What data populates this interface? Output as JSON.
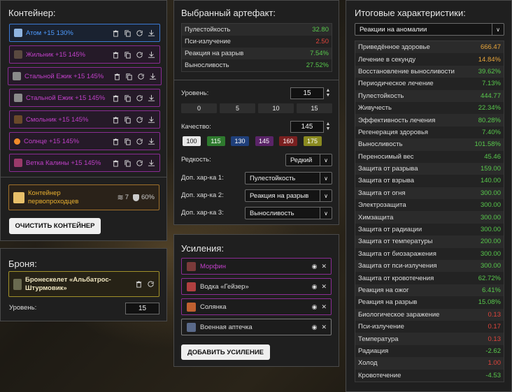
{
  "container": {
    "title": "Контейнер:",
    "items": [
      {
        "name": "Атом +15 130%",
        "color": "#4e9bff",
        "border": "#3b7ad4",
        "icon_color": "#8fb4e0",
        "icon": "atom-artifact-icon"
      },
      {
        "name": "Жильник +15 145%",
        "color": "#c040c8",
        "border": "#8a2c93",
        "icon_color": "#5a4a40",
        "icon": "zhilnik-artifact-icon"
      },
      {
        "name": "Стальной Ежик +15 145%",
        "color": "#c040c8",
        "border": "#8a2c93",
        "icon_color": "#8a8a8a",
        "icon": "steel-hedgehog-artifact-icon"
      },
      {
        "name": "Стальной Ежик +15 145%",
        "color": "#c040c8",
        "border": "#8a2c93",
        "icon_color": "#8a8a8a",
        "icon": "steel-hedgehog-artifact-icon"
      },
      {
        "name": "Смольник +15 145%",
        "color": "#c040c8",
        "border": "#8a2c93",
        "icon_color": "#6a4a2a",
        "icon": "smolnik-artifact-icon"
      },
      {
        "name": "Солнце +15 145%",
        "color": "#c040c8",
        "border": "#8a2c93",
        "icon_color": "#f08a2a",
        "icon": "sun-artifact-icon"
      },
      {
        "name": "Ветка Калины +15 145%",
        "color": "#c040c8",
        "border": "#8a2c93",
        "icon_color": "#9a3a6a",
        "icon": "viburnum-branch-artifact-icon"
      }
    ],
    "container_item": {
      "name": "Контейнер первопроходцев",
      "slots": "7",
      "protection": "60%"
    },
    "clear_button": "ОЧИСТИТЬ КОНТЕЙНЕР"
  },
  "armor": {
    "title": "Броня:",
    "name": "Бронескелет «Альбатрос-Штурмовик»",
    "level_label": "Уровень:",
    "level_value": "15"
  },
  "artifact": {
    "title": "Выбранный артефакт:",
    "stats": [
      {
        "label": "Пулестойкость",
        "value": "32.80",
        "color": "#58c94c"
      },
      {
        "label": "Пси-излучение",
        "value": "2.50",
        "color": "#e0453c"
      },
      {
        "label": "Реакция на разрыв",
        "value": "7.54%",
        "color": "#58c94c"
      },
      {
        "label": "Выносливость",
        "value": "27.52%",
        "color": "#58c94c"
      }
    ],
    "level_label": "Уровень:",
    "level_value": "15",
    "level_presets": [
      "0",
      "5",
      "10",
      "15"
    ],
    "quality_label": "Качество:",
    "quality_value": "145",
    "quality_presets": [
      {
        "label": "100",
        "bg": "#e8e8e8",
        "fg": "#111"
      },
      {
        "label": "115",
        "bg": "#2e7a2e",
        "fg": "#fff"
      },
      {
        "label": "130",
        "bg": "#1f3f7a",
        "fg": "#fff"
      },
      {
        "label": "145",
        "bg": "#5a2468",
        "fg": "#fff"
      },
      {
        "label": "160",
        "bg": "#7a2020",
        "fg": "#fff"
      },
      {
        "label": "175",
        "bg": "#8a8a20",
        "fg": "#fff"
      }
    ],
    "rarity_label": "Редкость:",
    "rarity_value": "Редкий",
    "extra_labels": [
      "Доп. хар-ка 1:",
      "Доп. хар-ка 2:",
      "Доп. хар-ка 3:"
    ],
    "extra_values": [
      "Пулестойкость",
      "Реакция на разрыв",
      "Выносливость"
    ]
  },
  "boosts": {
    "title": "Усиления:",
    "items": [
      {
        "name": "Морфин",
        "color": "#c040c8",
        "border": "#8a2c93",
        "icon_color": "#7a3a3a",
        "icon": "morphine-icon"
      },
      {
        "name": "Водка «Гейзер»",
        "color": "#ddd",
        "border": "#8a2c93",
        "icon_color": "#b04040",
        "icon": "vodka-icon"
      },
      {
        "name": "Солянка",
        "color": "#ddd",
        "border": "#8a2c93",
        "icon_color": "#c06030",
        "icon": "solyanka-icon"
      },
      {
        "name": "Военная аптечка",
        "color": "#ddd",
        "border": "#7a7a7a",
        "icon_color": "#5a6a8a",
        "icon": "military-medkit-icon"
      }
    ],
    "add_button": "ДОБАВИТЬ УСИЛЕНИЕ"
  },
  "totals": {
    "title": "Итоговые характеристики:",
    "filter_value": "Реакции на аномалии",
    "rows": [
      {
        "label": "Приведённое здоровье",
        "value": "666.47",
        "color": "#e8a53a"
      },
      {
        "label": "Лечение в секунду",
        "value": "14.84%",
        "color": "#e8a53a"
      },
      {
        "label": "Восстановление выносливости",
        "value": "39.62%",
        "color": "#58c94c"
      },
      {
        "label": "Периодическое лечение",
        "value": "7.13%",
        "color": "#58c94c"
      },
      {
        "label": "Пулестойкость",
        "value": "444.77",
        "color": "#58c94c"
      },
      {
        "label": "Живучесть",
        "value": "22.34%",
        "color": "#58c94c"
      },
      {
        "label": "Эффективность лечения",
        "value": "80.28%",
        "color": "#58c94c"
      },
      {
        "label": "Регенерация здоровья",
        "value": "7.40%",
        "color": "#58c94c"
      },
      {
        "label": "Выносливость",
        "value": "101.58%",
        "color": "#58c94c"
      },
      {
        "label": "Переносимый вес",
        "value": "45.46",
        "color": "#58c94c"
      },
      {
        "label": "Защита от разрыва",
        "value": "159.00",
        "color": "#58c94c"
      },
      {
        "label": "Защита от взрыва",
        "value": "140.00",
        "color": "#58c94c"
      },
      {
        "label": "Защита от огня",
        "value": "300.00",
        "color": "#58c94c"
      },
      {
        "label": "Электрозащита",
        "value": "300.00",
        "color": "#58c94c"
      },
      {
        "label": "Химзащита",
        "value": "300.00",
        "color": "#58c94c"
      },
      {
        "label": "Защита от радиации",
        "value": "300.00",
        "color": "#58c94c"
      },
      {
        "label": "Защита от температуры",
        "value": "200.00",
        "color": "#58c94c"
      },
      {
        "label": "Защита от биозаражения",
        "value": "300.00",
        "color": "#58c94c"
      },
      {
        "label": "Защита от пси-излучения",
        "value": "300.00",
        "color": "#58c94c"
      },
      {
        "label": "Защита от кровотечения",
        "value": "62.72%",
        "color": "#58c94c"
      },
      {
        "label": "Реакция на ожог",
        "value": "6.41%",
        "color": "#58c94c"
      },
      {
        "label": "Реакция на разрыв",
        "value": "15.08%",
        "color": "#58c94c"
      },
      {
        "label": "Биологическое заражение",
        "value": "0.13",
        "color": "#e0453c"
      },
      {
        "label": "Пси-излучение",
        "value": "0.17",
        "color": "#e0453c"
      },
      {
        "label": "Температура",
        "value": "0.13",
        "color": "#e0453c"
      },
      {
        "label": "Радиация",
        "value": "-2.62",
        "color": "#58c94c"
      },
      {
        "label": "Холод",
        "value": "1.00",
        "color": "#e0453c"
      },
      {
        "label": "Кровотечение",
        "value": "-4.53",
        "color": "#58c94c"
      }
    ]
  }
}
